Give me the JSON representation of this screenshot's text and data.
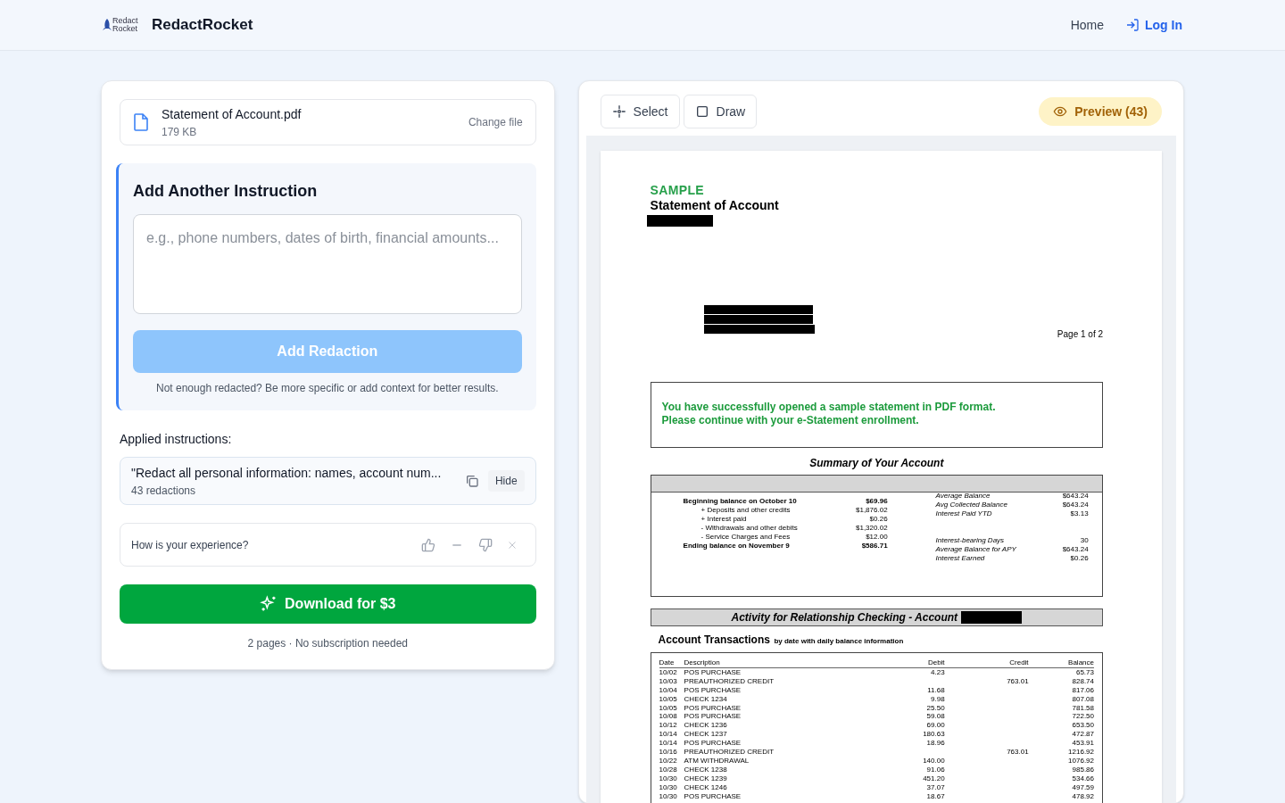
{
  "header": {
    "logo_text": "Redact Rocket",
    "brand": "RedactRocket",
    "nav": [
      {
        "label": "Home",
        "kind": "plain"
      },
      {
        "label": "Log In",
        "kind": "login"
      }
    ]
  },
  "file": {
    "name": "Statement of Account.pdf",
    "size": "179 KB",
    "action": "Change file"
  },
  "instruction": {
    "title": "Add Another Instruction",
    "placeholder": "e.g., phone numbers, dates of birth, financial amounts...",
    "button": "Add Redaction",
    "disabled": true,
    "hint": "Not enough redacted? Be more specific or add context for better results."
  },
  "applied": {
    "heading": "Applied instructions:",
    "items": [
      {
        "text": "\"Redact all personal information: names, account num...",
        "count": "43 redactions",
        "action": "Hide"
      }
    ]
  },
  "feedback": {
    "question": "How is your experience?"
  },
  "download": {
    "button": "Download for $3",
    "note": "2 pages · No subscription needed"
  },
  "toolbar": {
    "tools": [
      {
        "label": "Select",
        "kind": "select",
        "selected": false
      },
      {
        "label": "Draw",
        "kind": "draw",
        "selected": false
      }
    ],
    "preview": "Preview (43)"
  },
  "document": {
    "sample": "SAMPLE",
    "title": "Statement of Account",
    "page": "Page 1 of 2",
    "notice": [
      "You have successfully opened a sample statement in PDF format.",
      "Please continue with your e-Statement enrollment."
    ],
    "summary_title": "Summary of Your Account",
    "summary_left": [
      {
        "label": "Beginning balance on October 10",
        "value": "$69.96",
        "kind": "total"
      },
      {
        "label": "+ Deposits and other credits",
        "value": "$1,876.02",
        "kind": "item"
      },
      {
        "label": "+ Interest paid",
        "value": "$0.26",
        "kind": "item"
      },
      {
        "label": "- Withdrawals and other debits",
        "value": "$1,320.02",
        "kind": "item"
      },
      {
        "label": "- Service Charges and Fees",
        "value": "$12.00",
        "kind": "item"
      },
      {
        "label": "Ending balance on November 9",
        "value": "$586.71",
        "kind": "total"
      }
    ],
    "summary_right_top": [
      {
        "label": "Average Balance",
        "value": "$643.24"
      },
      {
        "label": "Avg Collected Balance",
        "value": "$643.24"
      },
      {
        "label": "Interest Paid YTD",
        "value": "$3.13"
      }
    ],
    "summary_right_bottom": [
      {
        "label": "Interest-bearing Days",
        "value": "30"
      },
      {
        "label": "Average Balance for APY",
        "value": "$643.24"
      },
      {
        "label": "Interest Earned",
        "value": "$0.26"
      }
    ],
    "activity_title": "Activity for Relationship Checking - Account",
    "transactions_title": "Account Transactions",
    "transactions_subtitle": "by date with daily balance information",
    "columns": [
      "Date",
      "Description",
      "Debit",
      "Credit",
      "Balance"
    ],
    "rows": [
      [
        "10/02",
        "POS PURCHASE",
        "4.23",
        "",
        "65.73"
      ],
      [
        "10/03",
        "PREAUTHORIZED CREDIT",
        "",
        "763.01",
        "828.74"
      ],
      [
        "10/04",
        "POS PURCHASE",
        "11.68",
        "",
        "817.06"
      ],
      [
        "10/05",
        "CHECK 1234",
        "9.98",
        "",
        "807.08"
      ],
      [
        "10/05",
        "POS PURCHASE",
        "25.50",
        "",
        "781.58"
      ],
      [
        "10/08",
        "POS PURCHASE",
        "59.08",
        "",
        "722.50"
      ],
      [
        "10/12",
        "CHECK 1236",
        "69.00",
        "",
        "653.50"
      ],
      [
        "10/14",
        "CHECK 1237",
        "180.63",
        "",
        "472.87"
      ],
      [
        "10/14",
        "POS PURCHASE",
        "18.96",
        "",
        "453.91"
      ],
      [
        "10/16",
        "PREAUTHORIZED CREDIT",
        "",
        "763.01",
        "1216.92"
      ],
      [
        "10/22",
        "ATM WITHDRAWAL",
        "140.00",
        "",
        "1076.92"
      ],
      [
        "10/28",
        "CHECK 1238",
        "91.06",
        "",
        "985.86"
      ],
      [
        "10/30",
        "CHECK 1239",
        "451.20",
        "",
        "534.66"
      ],
      [
        "10/30",
        "CHECK 1246",
        "37.07",
        "",
        "497.59"
      ],
      [
        "10/30",
        "POS PURCHASE",
        "18.67",
        "",
        "478.92"
      ]
    ]
  }
}
